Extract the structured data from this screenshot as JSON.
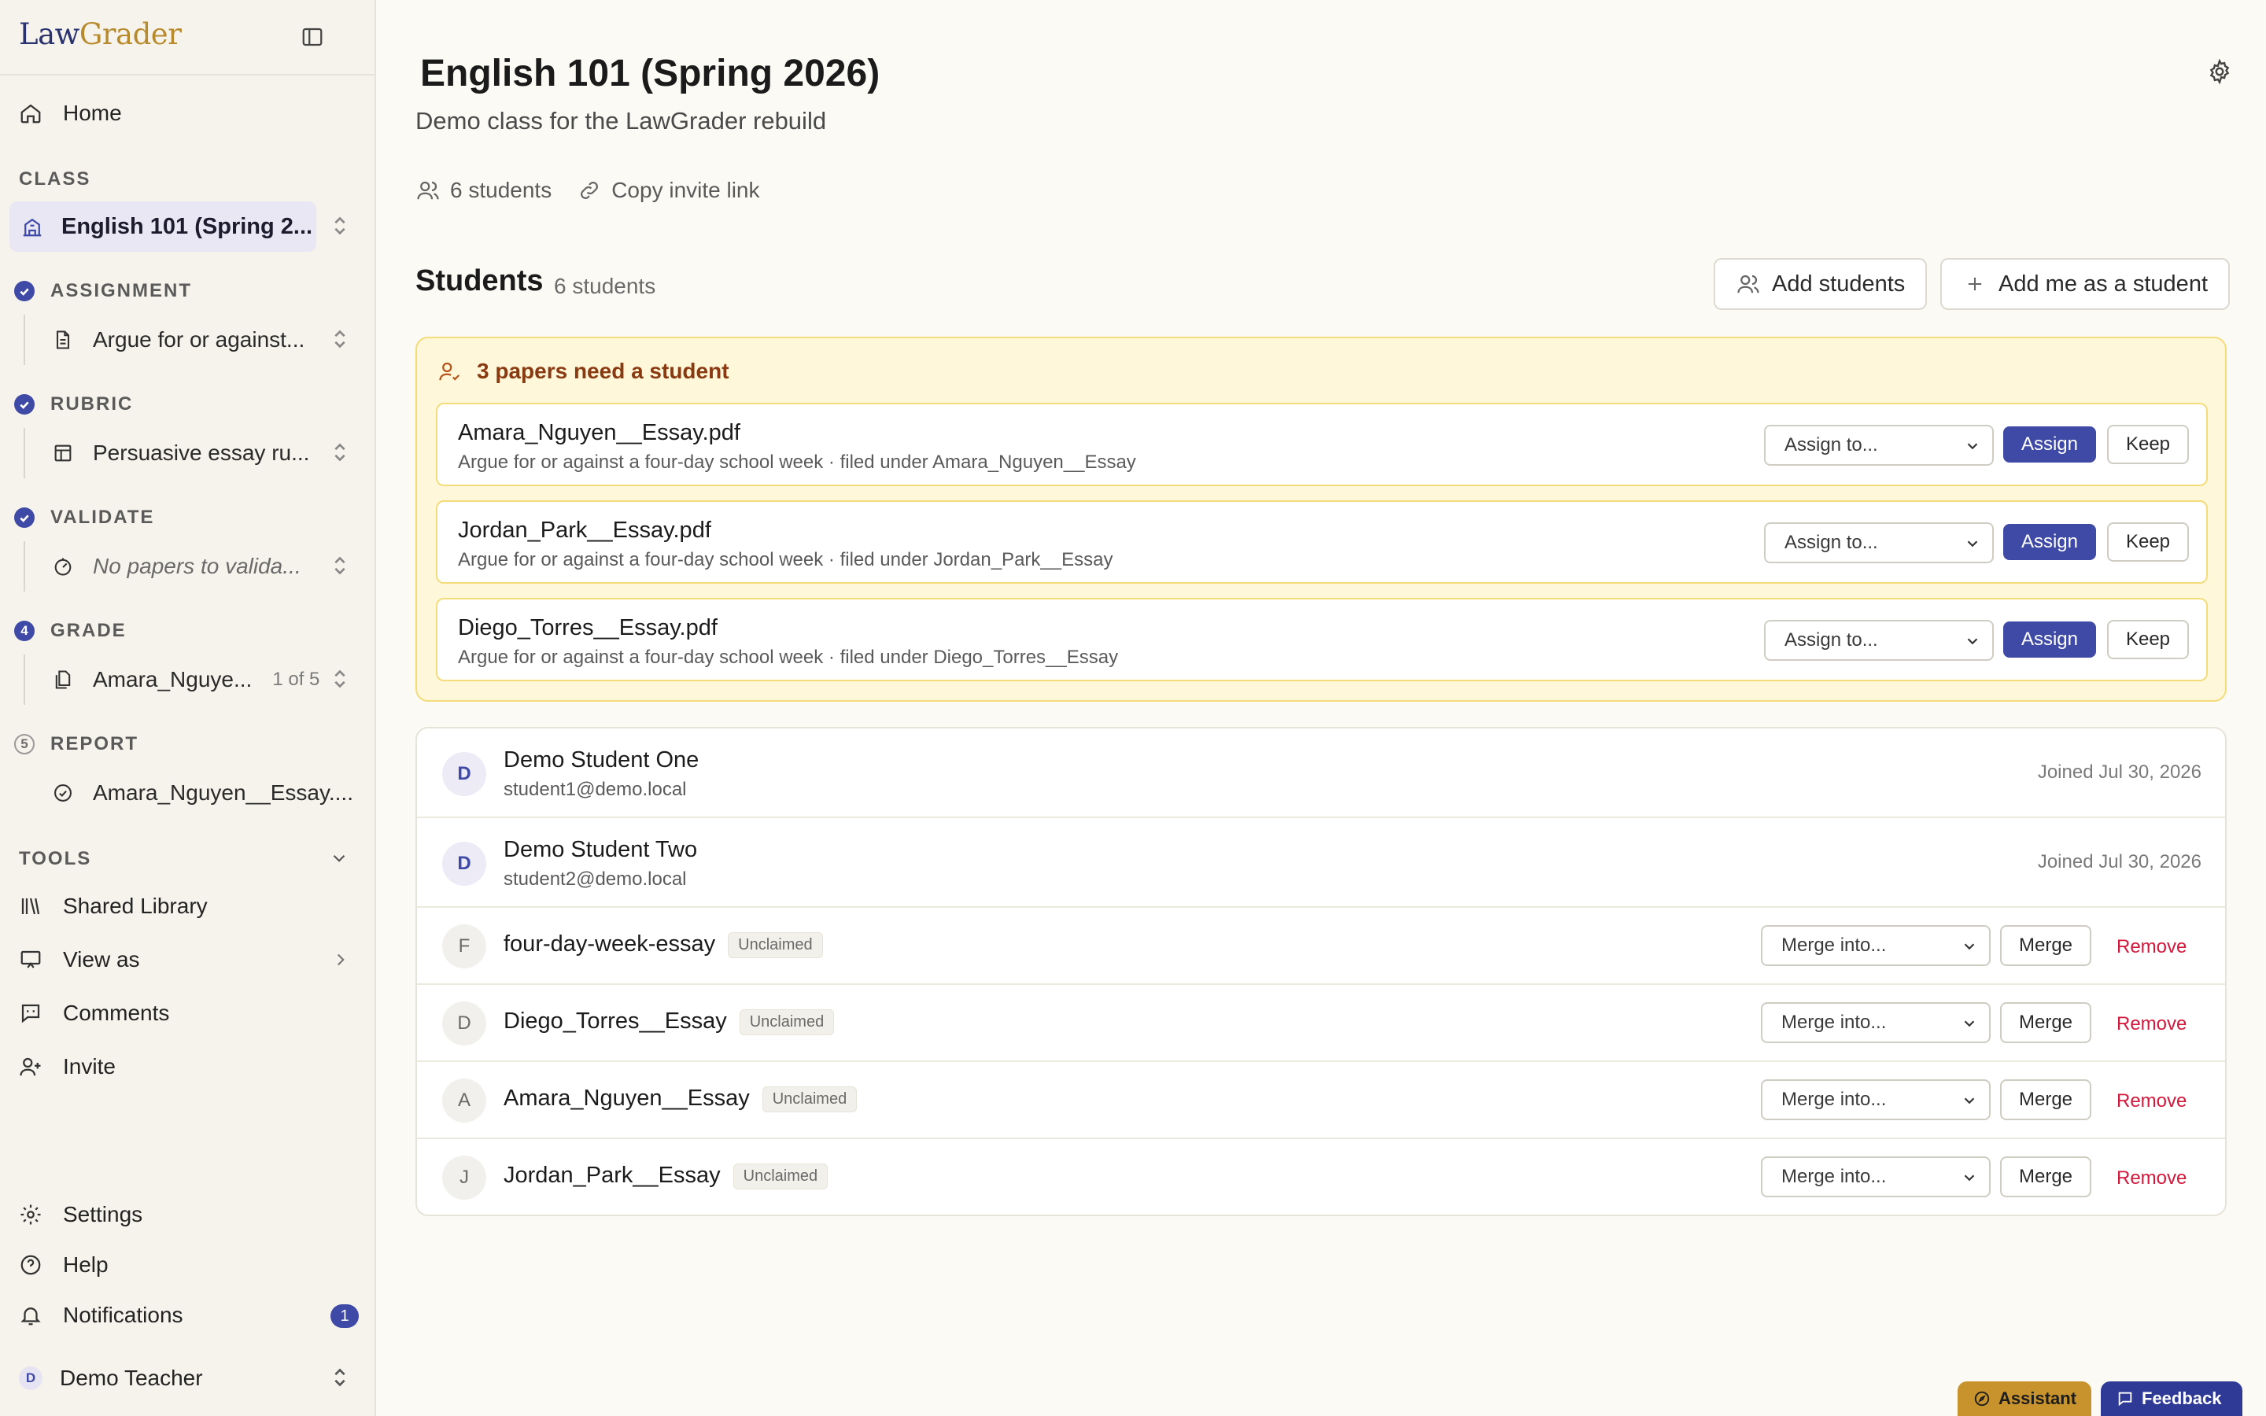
{
  "brand": {
    "part1": "Law",
    "part2": "Grader"
  },
  "sidebar": {
    "home": "Home",
    "class_label": "CLASS",
    "class_name": "English 101 (Spring 2...",
    "steps": [
      {
        "num": "✓",
        "label": "ASSIGNMENT",
        "item": "Argue for or against..."
      },
      {
        "num": "✓",
        "label": "RUBRIC",
        "item": "Persuasive essay ru..."
      },
      {
        "num": "✓",
        "label": "VALIDATE",
        "item": "No papers to valida..."
      },
      {
        "num": "4",
        "label": "GRADE",
        "item": "Amara_Nguye...",
        "count": "1 of 5"
      },
      {
        "num": "5",
        "label": "REPORT",
        "item": "Amara_Nguyen__Essay...."
      }
    ],
    "tools_label": "TOOLS",
    "tools": [
      "Shared Library",
      "View as",
      "Comments",
      "Invite"
    ],
    "settings": "Settings",
    "help": "Help",
    "notifications": "Notifications",
    "notifications_count": "1",
    "user_initial": "D",
    "user_name": "Demo Teacher"
  },
  "header": {
    "title": "English 101 (Spring 2026)",
    "subtitle": "Demo class for the LawGrader rebuild",
    "students_meta": "6 students",
    "copy_invite": "Copy invite link"
  },
  "students": {
    "title": "Students",
    "count": "6 students",
    "add_students": "Add students",
    "add_me": "Add me as a student"
  },
  "needs_student": {
    "heading": "3 papers need a student",
    "select_placeholder": "Assign to...",
    "assign_label": "Assign",
    "keep_label": "Keep",
    "papers": [
      {
        "file": "Amara_Nguyen__Essay.pdf",
        "meta": "Argue for or against a four-day school week · filed under Amara_Nguyen__Essay"
      },
      {
        "file": "Jordan_Park__Essay.pdf",
        "meta": "Argue for or against a four-day school week · filed under Jordan_Park__Essay"
      },
      {
        "file": "Diego_Torres__Essay.pdf",
        "meta": "Argue for or against a four-day school week · filed under Diego_Torres__Essay"
      }
    ]
  },
  "roster": {
    "merge_placeholder": "Merge into...",
    "merge_label": "Merge",
    "remove_label": "Remove",
    "unclaimed_label": "Unclaimed",
    "joined": [
      {
        "initial": "D",
        "name": "Demo Student One",
        "email": "student1@demo.local",
        "joined": "Joined Jul 30, 2026"
      },
      {
        "initial": "D",
        "name": "Demo Student Two",
        "email": "student2@demo.local",
        "joined": "Joined Jul 30, 2026"
      }
    ],
    "unclaimed": [
      {
        "initial": "F",
        "name": "four-day-week-essay"
      },
      {
        "initial": "D",
        "name": "Diego_Torres__Essay"
      },
      {
        "initial": "A",
        "name": "Amara_Nguyen__Essay"
      },
      {
        "initial": "J",
        "name": "Jordan_Park__Essay"
      }
    ]
  },
  "floating": {
    "assistant": "Assistant",
    "feedback": "Feedback"
  },
  "colors": {
    "accent": "#3f4aa6",
    "brand_gold": "#b88a2e",
    "warning_bg": "#fef7da",
    "danger": "#d4173a"
  }
}
